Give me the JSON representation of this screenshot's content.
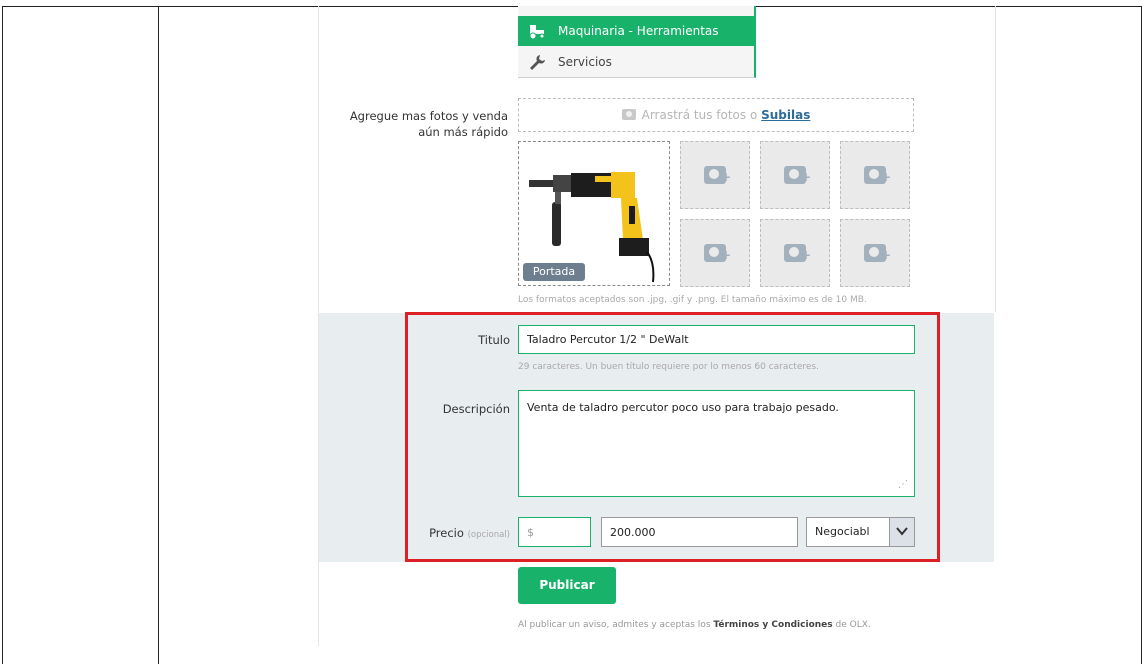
{
  "categories": {
    "active_label": "Maquinaria - Herramientas",
    "active_icon": "tractor-icon",
    "second_label": "Servicios",
    "second_icon": "wrench-icon"
  },
  "photos": {
    "label_line1": "Agregue mas fotos y venda",
    "label_line2": "aún más rápido",
    "dropzone_text": "Arrastrá tus fotos o",
    "dropzone_link": "Subilas",
    "cover_badge": "Portada",
    "formats_note": "Los formatos aceptados son .jpg, .gif y .png. El tamaño máximo es de 10 MB."
  },
  "form": {
    "title_label": "Titulo",
    "title_value": "Taladro Percutor 1/2 \" DeWalt",
    "title_hint": "29 caracteres. Un buen título requiere por lo menos 60 caracteres.",
    "description_label": "Descripción",
    "description_value": "Venta de taladro percutor poco uso para trabajo pesado.",
    "price_label": "Precio",
    "price_optional": "(opcional)",
    "currency_value": "$",
    "price_value": "200.000",
    "negotiable_value": "Negociabl"
  },
  "actions": {
    "publish_label": "Publicar",
    "legal_prefix": "Al publicar un aviso, admites y aceptas los",
    "legal_link": "Términos y Condiciones",
    "legal_suffix": "de OLX."
  },
  "colors": {
    "accent": "#19b26b",
    "highlight_box": "#dd1f26",
    "form_background": "#e8edf0"
  }
}
